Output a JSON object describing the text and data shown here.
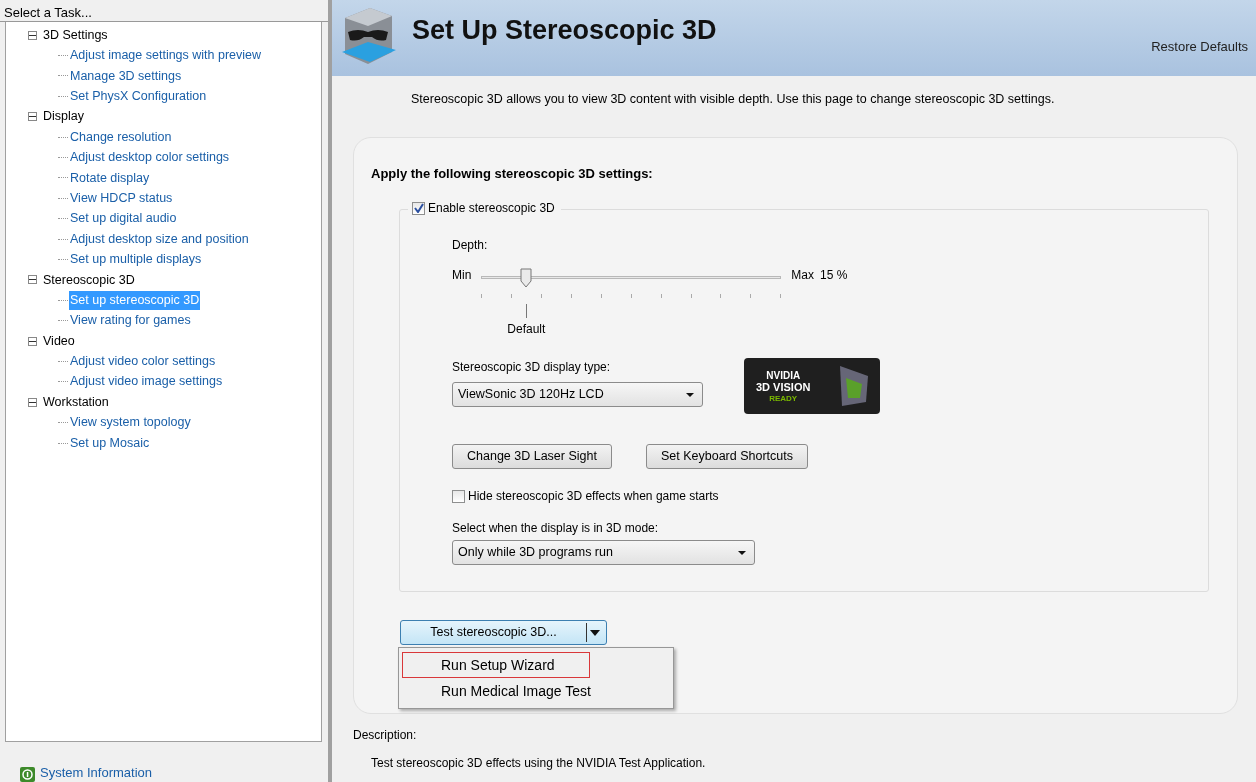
{
  "sidebar": {
    "title": "Select a Task...",
    "tree": [
      {
        "label": "3D Settings",
        "expanded": true,
        "children": [
          {
            "label": "Adjust image settings with preview",
            "selected": false
          },
          {
            "label": "Manage 3D settings",
            "selected": false
          },
          {
            "label": "Set PhysX Configuration",
            "selected": false
          }
        ]
      },
      {
        "label": "Display",
        "expanded": true,
        "children": [
          {
            "label": "Change resolution",
            "selected": false
          },
          {
            "label": "Adjust desktop color settings",
            "selected": false
          },
          {
            "label": "Rotate display",
            "selected": false
          },
          {
            "label": "View HDCP status",
            "selected": false
          },
          {
            "label": "Set up digital audio",
            "selected": false
          },
          {
            "label": "Adjust desktop size and position",
            "selected": false
          },
          {
            "label": "Set up multiple displays",
            "selected": false
          }
        ]
      },
      {
        "label": "Stereoscopic 3D",
        "expanded": true,
        "children": [
          {
            "label": "Set up stereoscopic 3D",
            "selected": true
          },
          {
            "label": "View rating for games",
            "selected": false
          }
        ]
      },
      {
        "label": "Video",
        "expanded": true,
        "children": [
          {
            "label": "Adjust video color settings",
            "selected": false
          },
          {
            "label": "Adjust video image settings",
            "selected": false
          }
        ]
      },
      {
        "label": "Workstation",
        "expanded": true,
        "children": [
          {
            "label": "View system topology",
            "selected": false
          },
          {
            "label": "Set up Mosaic",
            "selected": false
          }
        ]
      }
    ],
    "footer_link": "System Information"
  },
  "header": {
    "title": "Set Up Stereoscopic 3D",
    "restore_link": "Restore Defaults"
  },
  "intro": "Stereoscopic 3D allows you to view 3D content with visible depth. Use this page to change stereoscopic 3D settings.",
  "settings": {
    "heading": "Apply the following stereoscopic 3D settings:",
    "enable": {
      "label": "Enable stereoscopic 3D",
      "checked": true
    },
    "depth": {
      "label": "Depth:",
      "min_label": "Min",
      "max_label": "Max",
      "reading": "15 %",
      "default_label": "Default",
      "level": 0.15
    },
    "display_type": {
      "label": "Stereoscopic 3D display type:",
      "value": "ViewSonic 3D 120Hz LCD"
    },
    "badge": {
      "lines": [
        "NVIDIA",
        "3D VISION",
        "READY"
      ]
    },
    "buttons": [
      "Change 3D Laser Sight",
      "Set Keyboard Shortcuts"
    ],
    "hide_effects": {
      "label": "Hide stereoscopic 3D effects when game starts",
      "checked": false
    },
    "mode": {
      "label": "Select when the display is in 3D mode:",
      "value": "Only while 3D programs run"
    }
  },
  "test_button": {
    "label": "Test stereoscopic 3D..."
  },
  "test_menu": [
    {
      "label": "Run Setup Wizard",
      "selected": true
    },
    {
      "label": "Run Medical Image Test",
      "selected": false
    }
  ],
  "description": {
    "label": "Description:",
    "text": "Test stereoscopic 3D effects using the NVIDIA Test Application."
  }
}
